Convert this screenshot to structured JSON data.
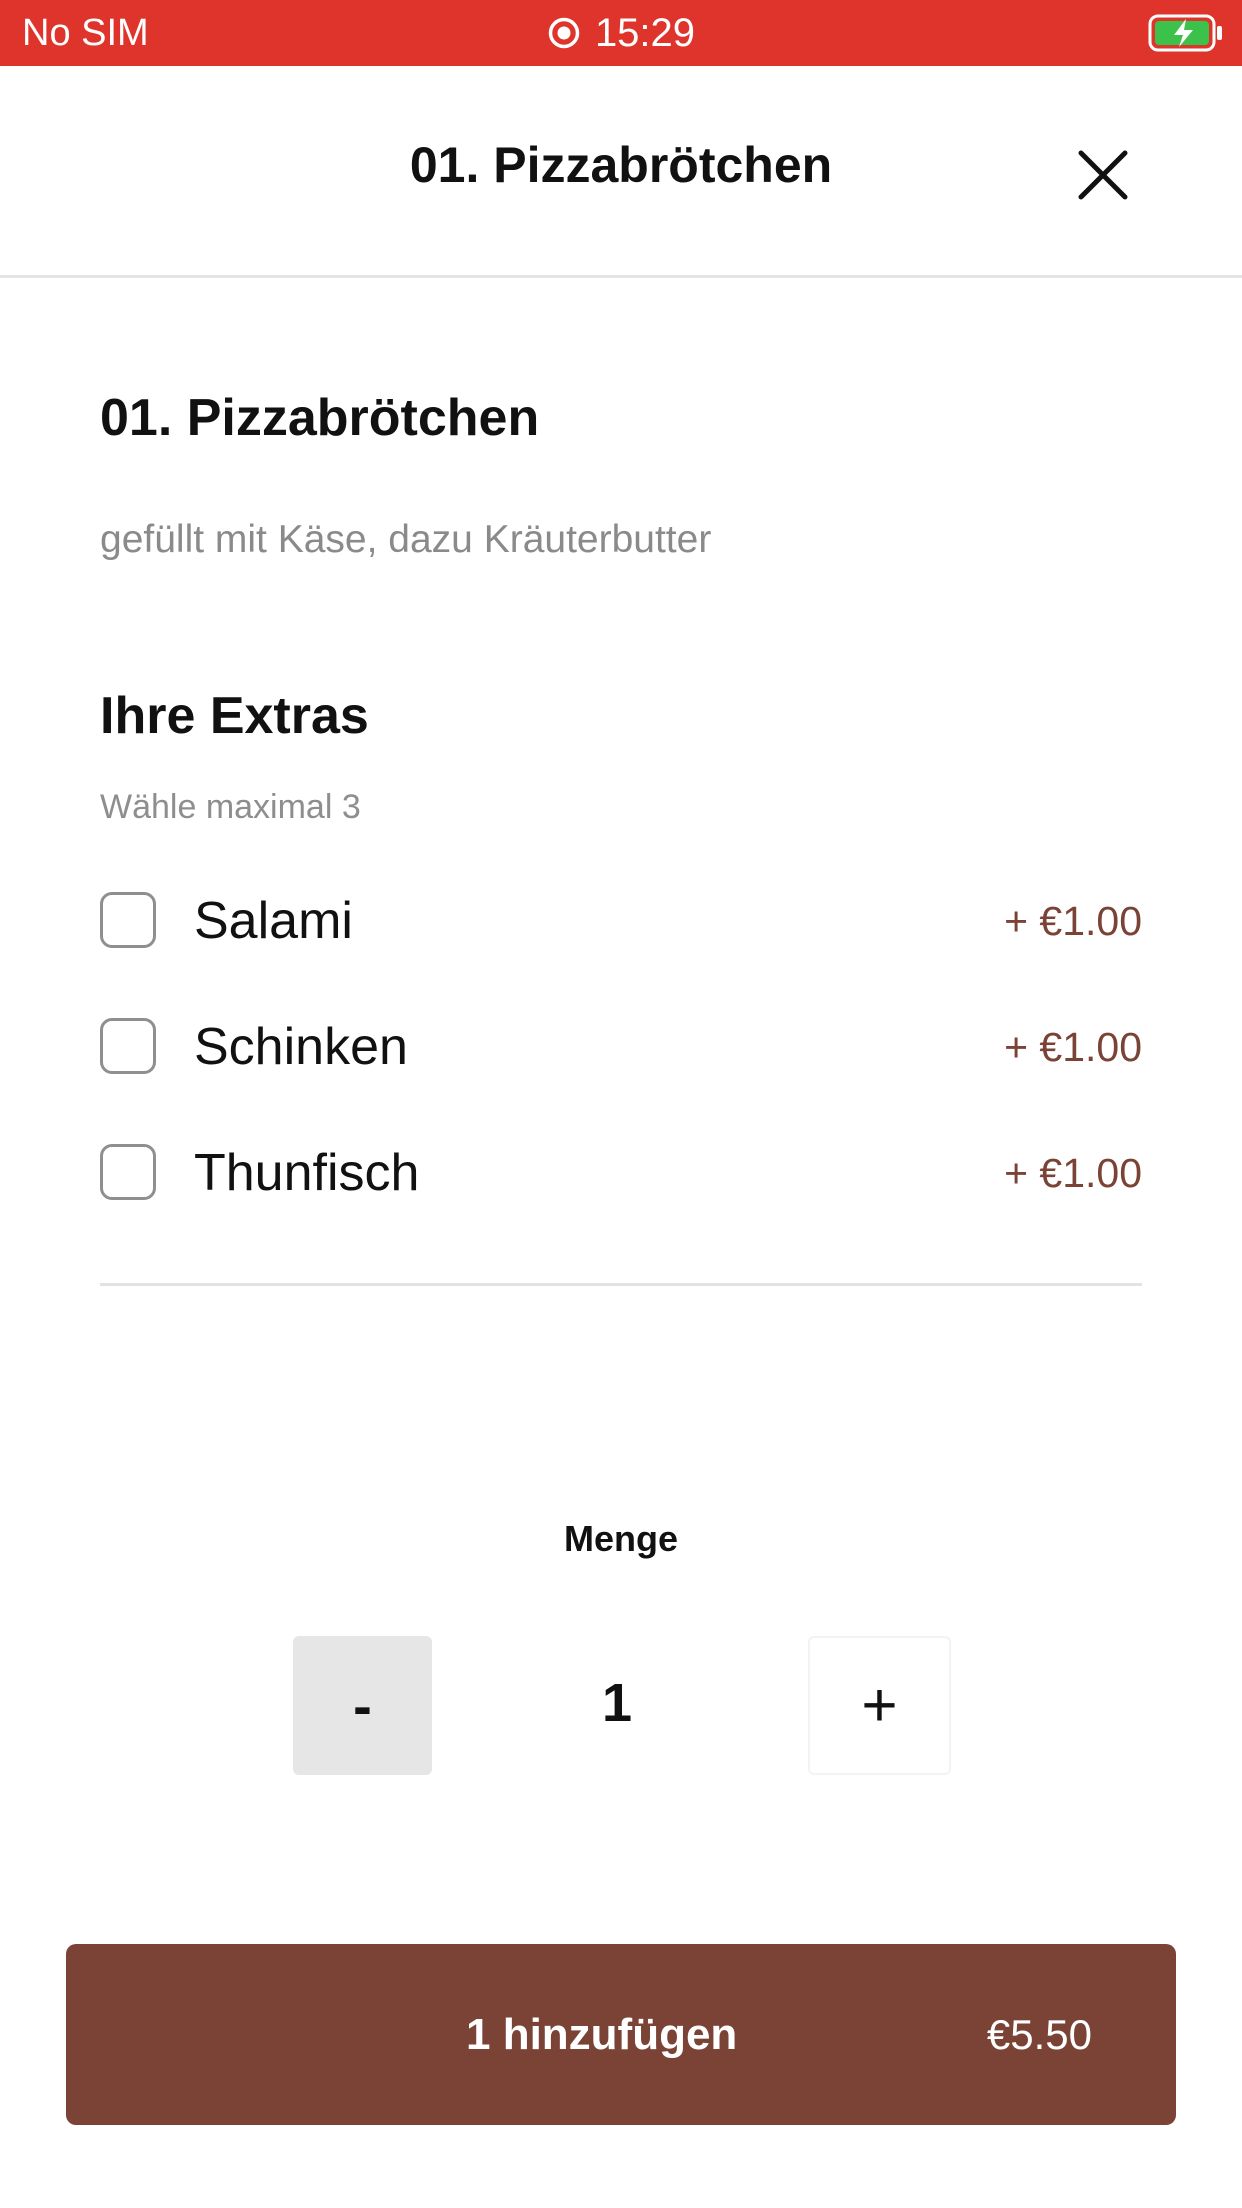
{
  "status_bar": {
    "carrier": "No SIM",
    "time": "15:29",
    "color": "#df342b"
  },
  "header": {
    "title": "01. Pizzabrötchen",
    "close_icon": "close-icon"
  },
  "product": {
    "name": "01. Pizzabrötchen",
    "description": "gefüllt mit Käse, dazu Kräuterbutter"
  },
  "extras": {
    "title": "Ihre Extras",
    "hint": "Wähle maximal 3",
    "items": [
      {
        "label": "Salami",
        "price": "+ €1.00",
        "checked": false
      },
      {
        "label": "Schinken",
        "price": "+ €1.00",
        "checked": false
      },
      {
        "label": "Thunfisch",
        "price": "+ €1.00",
        "checked": false
      }
    ]
  },
  "quantity": {
    "label": "Menge",
    "minus_label": "-",
    "value": "1",
    "plus_label": "+"
  },
  "add_button": {
    "label": "1 hinzufügen",
    "price": "€5.50",
    "color": "#7a4336"
  }
}
